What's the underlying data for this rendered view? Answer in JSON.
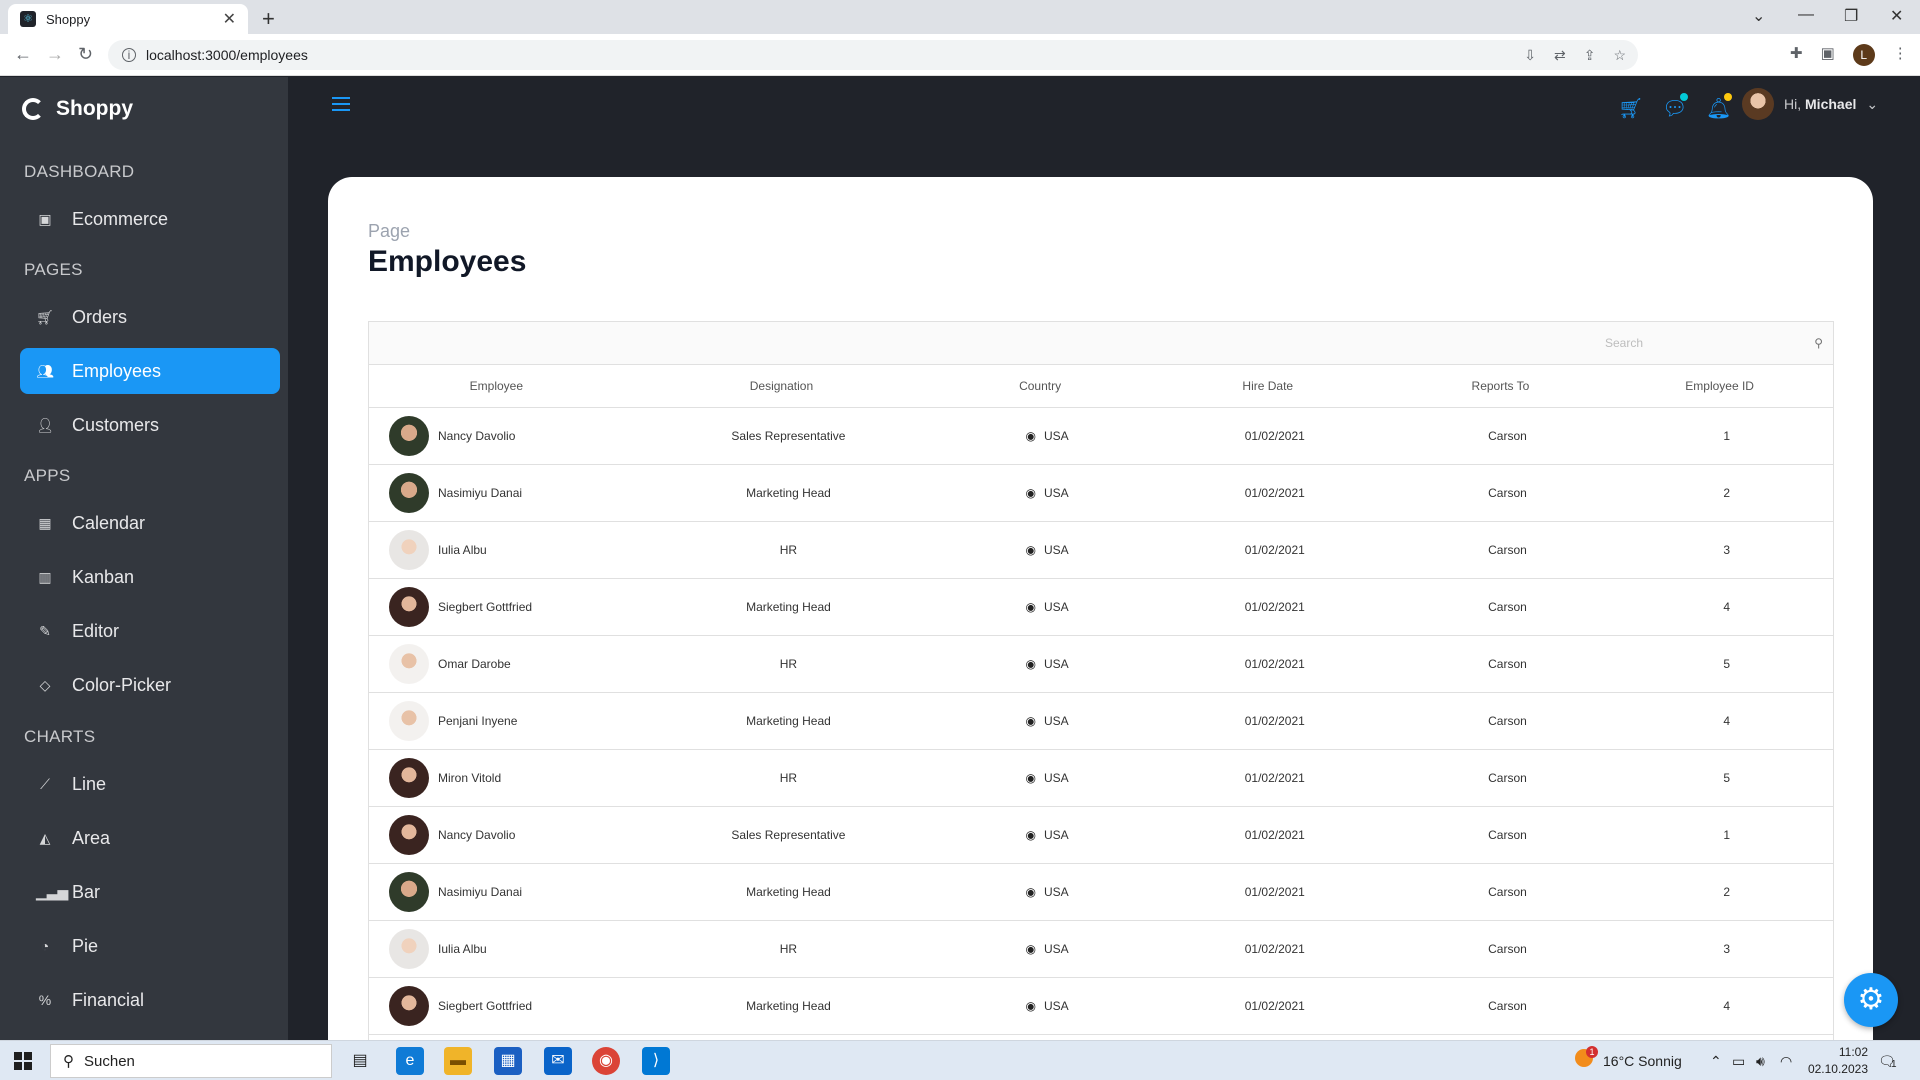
{
  "browser": {
    "tab_title": "Shoppy",
    "url": "localhost:3000/employees",
    "profile_initial": "L"
  },
  "sidebar": {
    "brand": "Shoppy",
    "sections": {
      "dashboard": "DASHBOARD",
      "pages": "PAGES",
      "apps": "APPS",
      "charts": "CHARTS"
    },
    "items": [
      {
        "label": "Ecommerce",
        "icon": "shopping-bag-icon"
      },
      {
        "label": "Orders",
        "icon": "cart-icon"
      },
      {
        "label": "Employees",
        "icon": "users-icon",
        "active": true
      },
      {
        "label": "Customers",
        "icon": "user-icon"
      },
      {
        "label": "Calendar",
        "icon": "calendar-icon"
      },
      {
        "label": "Kanban",
        "icon": "kanban-icon"
      },
      {
        "label": "Editor",
        "icon": "edit-icon"
      },
      {
        "label": "Color-Picker",
        "icon": "color-bucket-icon"
      },
      {
        "label": "Line",
        "icon": "line-chart-icon"
      },
      {
        "label": "Area",
        "icon": "area-chart-icon"
      },
      {
        "label": "Bar",
        "icon": "bar-chart-icon"
      },
      {
        "label": "Pie",
        "icon": "pie-chart-icon"
      },
      {
        "label": "Financial",
        "icon": "financial-icon"
      }
    ]
  },
  "navbar": {
    "greeting": "Hi,",
    "user_name": "Michael",
    "accent": "#1a97f5"
  },
  "page": {
    "subtitle": "Page",
    "title": "Employees",
    "search_placeholder": "Search"
  },
  "table": {
    "columns": [
      "Employee",
      "Designation",
      "Country",
      "Hire Date",
      "Reports To",
      "Employee ID"
    ],
    "rows": [
      {
        "name": "Nancy Davolio",
        "designation": "Sales Representative",
        "country": "USA",
        "hire_date": "01/02/2021",
        "reports_to": "Carson",
        "id": "1"
      },
      {
        "name": "Nasimiyu Danai",
        "designation": "Marketing Head",
        "country": "USA",
        "hire_date": "01/02/2021",
        "reports_to": "Carson",
        "id": "2"
      },
      {
        "name": "Iulia Albu",
        "designation": "HR",
        "country": "USA",
        "hire_date": "01/02/2021",
        "reports_to": "Carson",
        "id": "3"
      },
      {
        "name": "Siegbert Gottfried",
        "designation": "Marketing Head",
        "country": "USA",
        "hire_date": "01/02/2021",
        "reports_to": "Carson",
        "id": "4"
      },
      {
        "name": "Omar Darobe",
        "designation": "HR",
        "country": "USA",
        "hire_date": "01/02/2021",
        "reports_to": "Carson",
        "id": "5"
      },
      {
        "name": "Penjani Inyene",
        "designation": "Marketing Head",
        "country": "USA",
        "hire_date": "01/02/2021",
        "reports_to": "Carson",
        "id": "4"
      },
      {
        "name": "Miron Vitold",
        "designation": "HR",
        "country": "USA",
        "hire_date": "01/02/2021",
        "reports_to": "Carson",
        "id": "5"
      },
      {
        "name": "Nancy Davolio",
        "designation": "Sales Representative",
        "country": "USA",
        "hire_date": "01/02/2021",
        "reports_to": "Carson",
        "id": "1"
      },
      {
        "name": "Nasimiyu Danai",
        "designation": "Marketing Head",
        "country": "USA",
        "hire_date": "01/02/2021",
        "reports_to": "Carson",
        "id": "2"
      },
      {
        "name": "Iulia Albu",
        "designation": "HR",
        "country": "USA",
        "hire_date": "01/02/2021",
        "reports_to": "Carson",
        "id": "3"
      },
      {
        "name": "Siegbert Gottfried",
        "designation": "Marketing Head",
        "country": "USA",
        "hire_date": "01/02/2021",
        "reports_to": "Carson",
        "id": "4"
      }
    ]
  },
  "taskbar": {
    "search_label": "Suchen",
    "weather": "16°C  Sonnig",
    "weather_badge": "1",
    "time": "11:02",
    "date": "02.10.2023",
    "notification_count": "1"
  }
}
